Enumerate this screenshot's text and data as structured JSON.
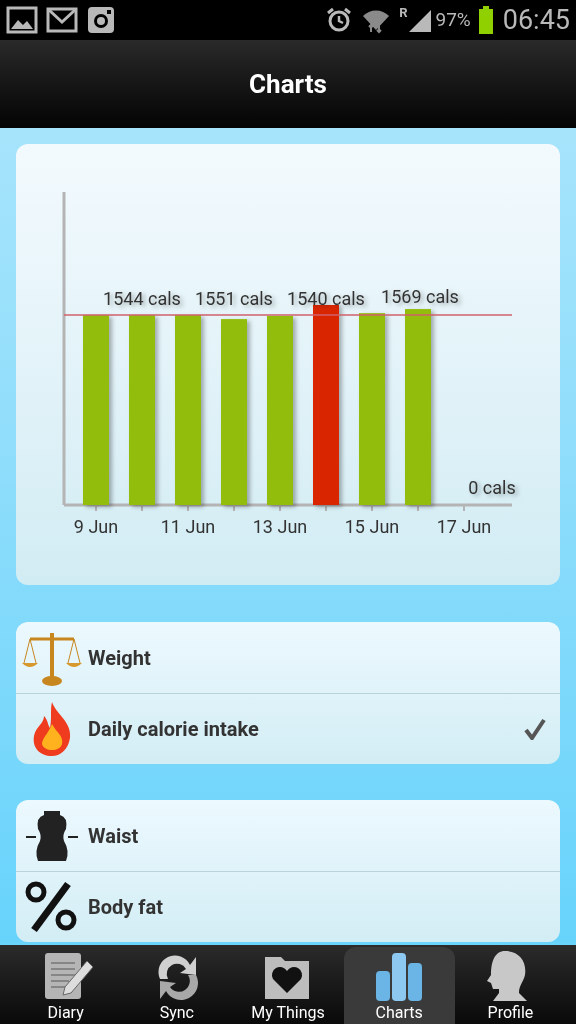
{
  "status_bar": {
    "roaming": "R",
    "battery": "97%",
    "time": "06:45"
  },
  "header": {
    "title": "Charts"
  },
  "chart": {
    "bars": [
      {
        "color": "#93bd09"
      },
      {
        "color": "#93bd09"
      },
      {
        "color": "#93bd09"
      },
      {
        "color": "#93bd09"
      },
      {
        "color": "#93bd09"
      },
      {
        "color": "#d92500"
      },
      {
        "color": "#93bd09"
      },
      {
        "color": "#93bd09"
      }
    ],
    "x_labels": [
      "9 Jun",
      "11 Jun",
      "13 Jun",
      "15 Jun",
      "17 Jun"
    ],
    "value_labels": [
      "1544 cals",
      "1551 cals",
      "1540 cals",
      "1569 cals",
      "0 cals"
    ]
  },
  "groups": [
    {
      "items": [
        {
          "label": "Weight",
          "selected": false
        },
        {
          "label": "Daily calorie intake",
          "selected": true
        }
      ]
    },
    {
      "items": [
        {
          "label": "Waist",
          "selected": false
        },
        {
          "label": "Body fat",
          "selected": false
        }
      ]
    }
  ],
  "tabs": [
    {
      "label": "Diary",
      "selected": false
    },
    {
      "label": "Sync",
      "selected": false
    },
    {
      "label": "My Things",
      "selected": false
    },
    {
      "label": "Charts",
      "selected": true
    },
    {
      "label": "Profile",
      "selected": false
    }
  ]
}
